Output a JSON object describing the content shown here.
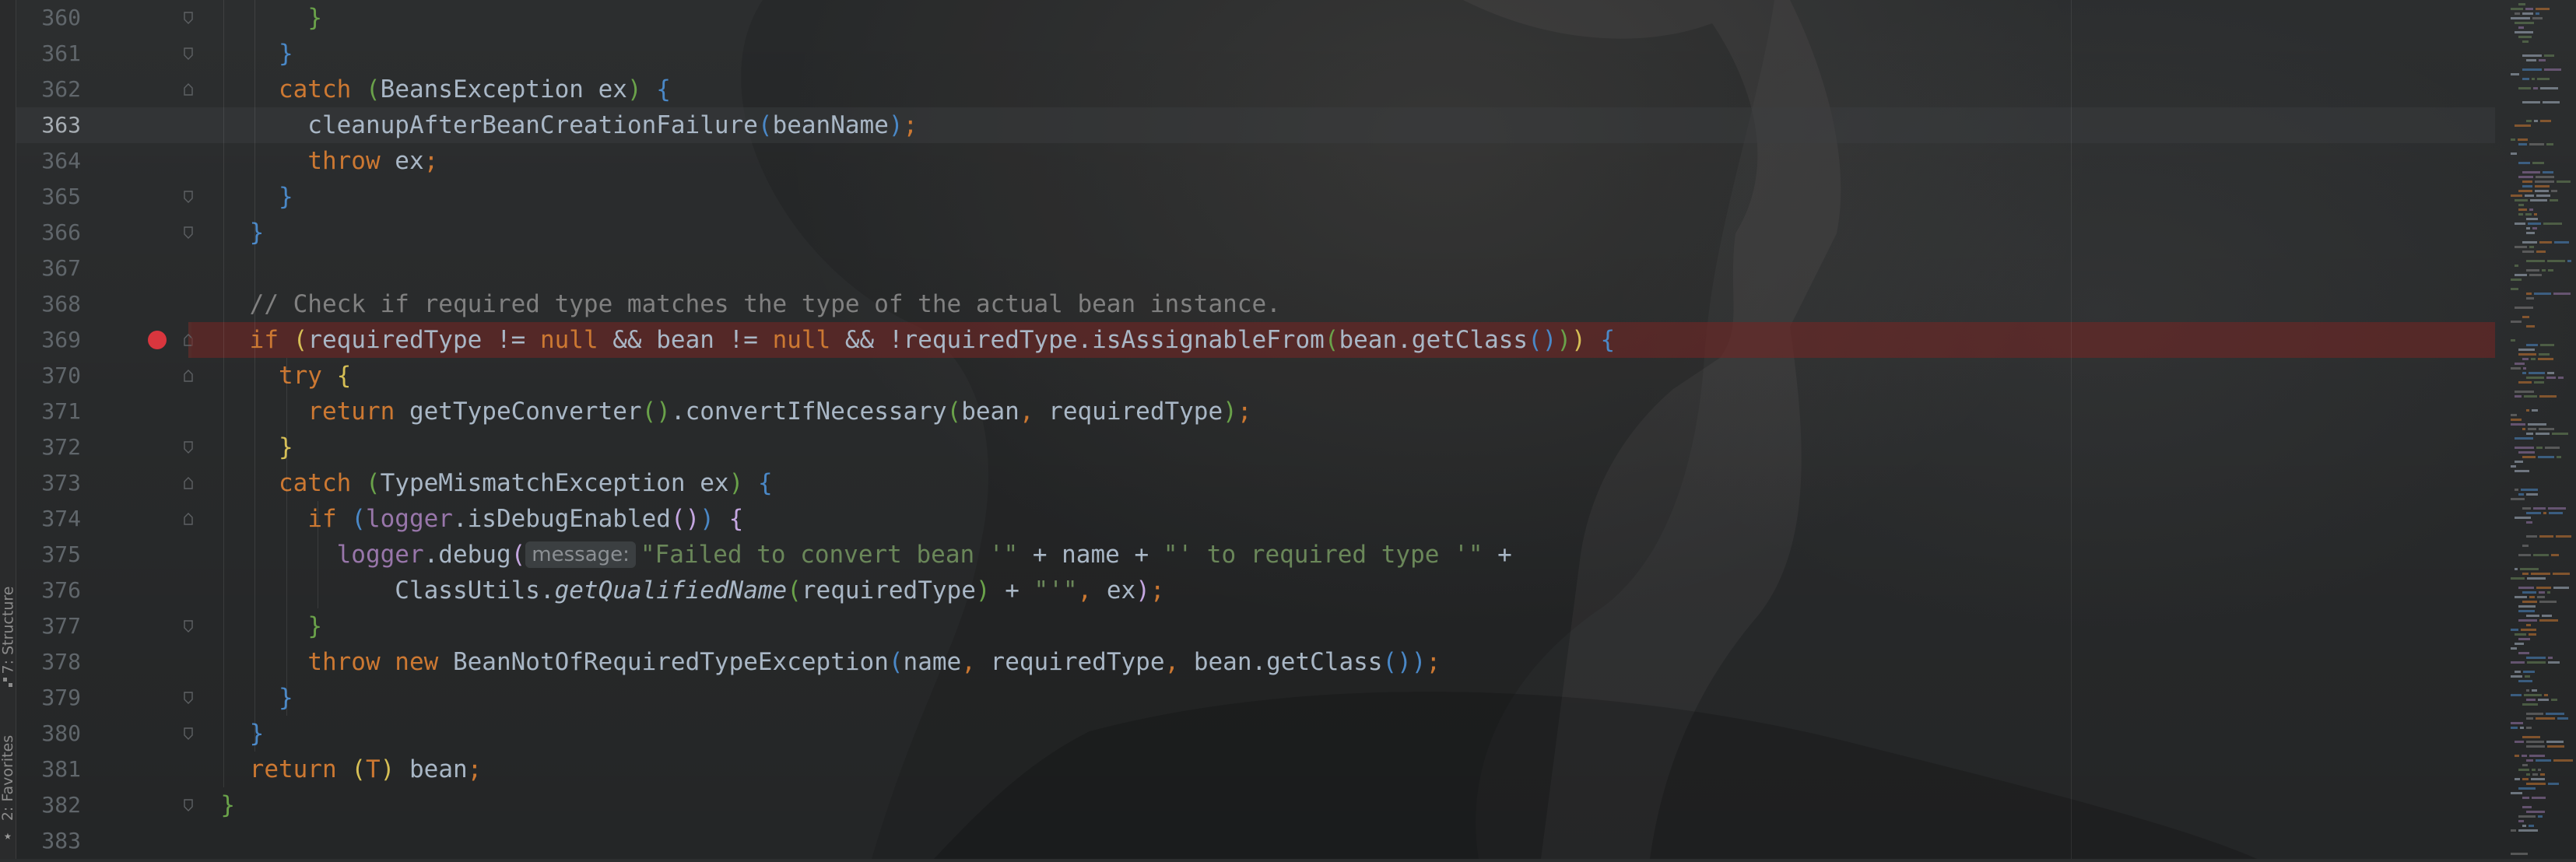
{
  "left_tool_window": {
    "structure_label": "7: Structure",
    "favorites_label": "2: Favorites",
    "favorites_icon": "star-icon",
    "structure_icon": "structure-icon"
  },
  "editor": {
    "current_line": "363",
    "breakpoint_line": "369",
    "breakpoint_color": "#d9363e",
    "lines": [
      {
        "no": "360",
        "tokens": [
          {
            "t": "        ",
            "c": "plain"
          },
          {
            "t": "}",
            "c": "b2"
          }
        ]
      },
      {
        "no": "361",
        "tokens": [
          {
            "t": "      ",
            "c": "plain"
          },
          {
            "t": "}",
            "c": "b3"
          }
        ]
      },
      {
        "no": "362",
        "tokens": [
          {
            "t": "      ",
            "c": "plain"
          },
          {
            "t": "catch",
            "c": "kw"
          },
          {
            "t": " ",
            "c": "plain"
          },
          {
            "t": "(",
            "c": "b2"
          },
          {
            "t": "BeansException ex",
            "c": "plain"
          },
          {
            "t": ")",
            "c": "b2"
          },
          {
            "t": " ",
            "c": "plain"
          },
          {
            "t": "{",
            "c": "b3"
          }
        ]
      },
      {
        "no": "363",
        "tokens": [
          {
            "t": "        cleanupAfterBeanCreationFailure",
            "c": "plain"
          },
          {
            "t": "(",
            "c": "b3"
          },
          {
            "t": "beanName",
            "c": "plain"
          },
          {
            "t": ")",
            "c": "b3"
          },
          {
            "t": ";",
            "c": "kw"
          }
        ]
      },
      {
        "no": "364",
        "tokens": [
          {
            "t": "        ",
            "c": "plain"
          },
          {
            "t": "throw",
            "c": "kw"
          },
          {
            "t": " ex",
            "c": "plain"
          },
          {
            "t": ";",
            "c": "kw"
          }
        ]
      },
      {
        "no": "365",
        "tokens": [
          {
            "t": "      ",
            "c": "plain"
          },
          {
            "t": "}",
            "c": "b3"
          }
        ]
      },
      {
        "no": "366",
        "tokens": [
          {
            "t": "    ",
            "c": "plain"
          },
          {
            "t": "}",
            "c": "b3"
          }
        ]
      },
      {
        "no": "367",
        "tokens": []
      },
      {
        "no": "368",
        "tokens": [
          {
            "t": "    // Check if required type matches the type of the actual bean instance.",
            "c": "com"
          }
        ]
      },
      {
        "no": "369",
        "tokens": [
          {
            "t": "    ",
            "c": "plain"
          },
          {
            "t": "if",
            "c": "kw"
          },
          {
            "t": " ",
            "c": "plain"
          },
          {
            "t": "(",
            "c": "b1"
          },
          {
            "t": "requiredType != ",
            "c": "plain"
          },
          {
            "t": "null",
            "c": "kw"
          },
          {
            "t": " && bean != ",
            "c": "plain"
          },
          {
            "t": "null",
            "c": "kw"
          },
          {
            "t": " && !requiredType.isAssignableFrom",
            "c": "plain"
          },
          {
            "t": "(",
            "c": "b2"
          },
          {
            "t": "bean.getClass",
            "c": "plain"
          },
          {
            "t": "()",
            "c": "b3"
          },
          {
            "t": ")",
            "c": "b2"
          },
          {
            "t": ")",
            "c": "b1"
          },
          {
            "t": " ",
            "c": "plain"
          },
          {
            "t": "{",
            "c": "b3"
          }
        ]
      },
      {
        "no": "370",
        "tokens": [
          {
            "t": "      ",
            "c": "plain"
          },
          {
            "t": "try",
            "c": "kw"
          },
          {
            "t": " ",
            "c": "plain"
          },
          {
            "t": "{",
            "c": "b1"
          }
        ]
      },
      {
        "no": "371",
        "tokens": [
          {
            "t": "        ",
            "c": "plain"
          },
          {
            "t": "return",
            "c": "kw"
          },
          {
            "t": " getTypeConverter",
            "c": "plain"
          },
          {
            "t": "()",
            "c": "b2"
          },
          {
            "t": ".convertIfNecessary",
            "c": "plain"
          },
          {
            "t": "(",
            "c": "b2"
          },
          {
            "t": "bean",
            "c": "plain"
          },
          {
            "t": ", ",
            "c": "kw"
          },
          {
            "t": "requiredType",
            "c": "plain"
          },
          {
            "t": ")",
            "c": "b2"
          },
          {
            "t": ";",
            "c": "kw"
          }
        ]
      },
      {
        "no": "372",
        "tokens": [
          {
            "t": "      ",
            "c": "plain"
          },
          {
            "t": "}",
            "c": "b1"
          }
        ]
      },
      {
        "no": "373",
        "tokens": [
          {
            "t": "      ",
            "c": "plain"
          },
          {
            "t": "catch",
            "c": "kw"
          },
          {
            "t": " ",
            "c": "plain"
          },
          {
            "t": "(",
            "c": "b2"
          },
          {
            "t": "TypeMismatchException ex",
            "c": "plain"
          },
          {
            "t": ")",
            "c": "b2"
          },
          {
            "t": " ",
            "c": "plain"
          },
          {
            "t": "{",
            "c": "b3"
          }
        ]
      },
      {
        "no": "374",
        "tokens": [
          {
            "t": "        ",
            "c": "plain"
          },
          {
            "t": "if",
            "c": "kw"
          },
          {
            "t": " ",
            "c": "plain"
          },
          {
            "t": "(",
            "c": "b3"
          },
          {
            "t": "logger",
            "c": "fld"
          },
          {
            "t": ".isDebugEnabled",
            "c": "plain"
          },
          {
            "t": "()",
            "c": "b4"
          },
          {
            "t": ")",
            "c": "b3"
          },
          {
            "t": " ",
            "c": "plain"
          },
          {
            "t": "{",
            "c": "b4"
          }
        ]
      },
      {
        "no": "375",
        "tokens": [
          {
            "t": "          ",
            "c": "plain"
          },
          {
            "t": "logger",
            "c": "fld"
          },
          {
            "t": ".debug",
            "c": "plain"
          },
          {
            "t": "(",
            "c": "b4"
          },
          {
            "t": "message:",
            "c": "hint"
          },
          {
            "t": "\"Failed to convert bean '\"",
            "c": "str"
          },
          {
            "t": " + name + ",
            "c": "plain"
          },
          {
            "t": "\"' to required type '\"",
            "c": "str"
          },
          {
            "t": " +",
            "c": "plain"
          }
        ]
      },
      {
        "no": "376",
        "tokens": [
          {
            "t": "              ClassUtils.",
            "c": "plain"
          },
          {
            "t": "getQualifiedName",
            "c": "ital"
          },
          {
            "t": "(",
            "c": "b2"
          },
          {
            "t": "requiredType",
            "c": "plain"
          },
          {
            "t": ")",
            "c": "b2"
          },
          {
            "t": " + ",
            "c": "plain"
          },
          {
            "t": "\"'\"",
            "c": "str"
          },
          {
            "t": ", ",
            "c": "kw"
          },
          {
            "t": "ex",
            "c": "plain"
          },
          {
            "t": ")",
            "c": "b4"
          },
          {
            "t": ";",
            "c": "kw"
          }
        ]
      },
      {
        "no": "377",
        "tokens": [
          {
            "t": "        ",
            "c": "plain"
          },
          {
            "t": "}",
            "c": "b2"
          }
        ]
      },
      {
        "no": "378",
        "tokens": [
          {
            "t": "        ",
            "c": "plain"
          },
          {
            "t": "throw new",
            "c": "kw"
          },
          {
            "t": " BeanNotOfRequiredTypeException",
            "c": "plain"
          },
          {
            "t": "(",
            "c": "b3"
          },
          {
            "t": "name",
            "c": "plain"
          },
          {
            "t": ", ",
            "c": "kw"
          },
          {
            "t": "requiredType",
            "c": "plain"
          },
          {
            "t": ", ",
            "c": "kw"
          },
          {
            "t": "bean.getClass",
            "c": "plain"
          },
          {
            "t": "()",
            "c": "b3"
          },
          {
            "t": ")",
            "c": "b3"
          },
          {
            "t": ";",
            "c": "kw"
          }
        ]
      },
      {
        "no": "379",
        "tokens": [
          {
            "t": "      ",
            "c": "plain"
          },
          {
            "t": "}",
            "c": "b3"
          }
        ]
      },
      {
        "no": "380",
        "tokens": [
          {
            "t": "    ",
            "c": "plain"
          },
          {
            "t": "}",
            "c": "b3"
          }
        ]
      },
      {
        "no": "381",
        "tokens": [
          {
            "t": "    ",
            "c": "plain"
          },
          {
            "t": "return",
            "c": "kw"
          },
          {
            "t": " ",
            "c": "plain"
          },
          {
            "t": "(",
            "c": "b1"
          },
          {
            "t": "T",
            "c": "kw"
          },
          {
            "t": ")",
            "c": "b1"
          },
          {
            "t": " bean",
            "c": "plain"
          },
          {
            "t": ";",
            "c": "kw"
          }
        ]
      },
      {
        "no": "382",
        "tokens": [
          {
            "t": "  ",
            "c": "plain"
          },
          {
            "t": "}",
            "c": "b2"
          }
        ]
      },
      {
        "no": "383",
        "tokens": []
      }
    ]
  }
}
